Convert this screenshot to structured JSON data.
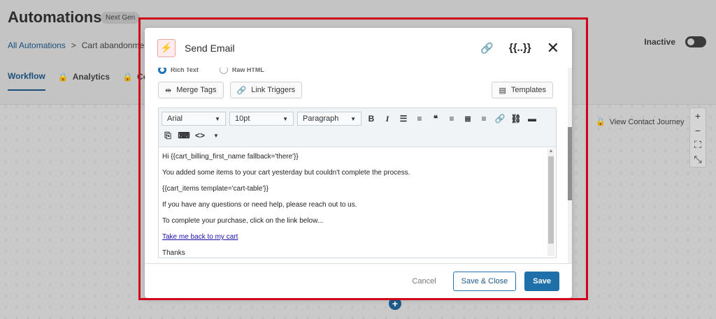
{
  "app": {
    "title": "Automations",
    "badge": "Next Gen",
    "breadcrumb": {
      "root": "All Automations",
      "separator": ">",
      "current": "Cart abandonment"
    },
    "tabs": [
      {
        "label": "Workflow"
      },
      {
        "label": "Analytics"
      },
      {
        "label": "Cont"
      }
    ],
    "status_label": "Inactive",
    "journey_label": "View Contact Journey",
    "zoom_controls": [
      "+",
      "−",
      "⛶",
      "⤡"
    ],
    "add_node": "+"
  },
  "modal": {
    "title": "Send Email",
    "icons": {
      "link": "🔗",
      "merge": "{{..}}",
      "close": "✕"
    },
    "radios": [
      "Rich Text",
      "Raw HTML"
    ],
    "buttons": {
      "merge_tags": "Merge Tags",
      "link_triggers": "Link Triggers",
      "templates": "Templates"
    },
    "toolbar": {
      "font": "Arial",
      "size": "10pt",
      "block": "Paragraph"
    },
    "content": [
      "Hi {{cart_billing_first_name fallback='there'}}",
      "You added some items to your cart yesterday but couldn't complete the process.",
      "{{cart_items template='cart-table'}}",
      "If you have any questions or need help, please reach out to us.",
      "To complete your purchase, click on the link below..."
    ],
    "link_text": "Take me back to my cart",
    "sign_off": "Thanks",
    "footer": {
      "cancel": "Cancel",
      "save_close": "Save & Close",
      "save": "Save"
    }
  },
  "colors": {
    "highlight": "#d0021b",
    "primary": "#1f6fa8",
    "accent_icon": "#d9534f"
  }
}
